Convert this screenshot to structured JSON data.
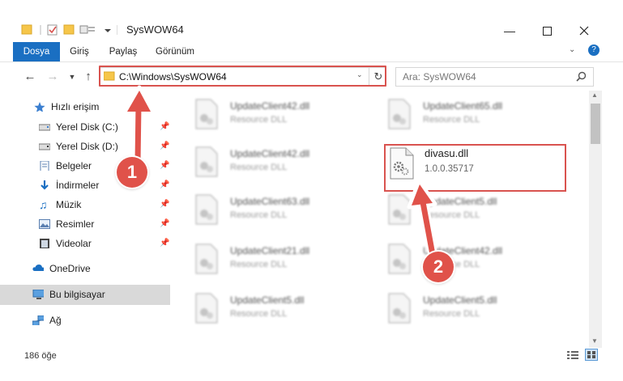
{
  "window": {
    "title": "SysWOW64"
  },
  "ribbon": {
    "tabs": [
      {
        "label": "Dosya"
      },
      {
        "label": "Giriş"
      },
      {
        "label": "Paylaş"
      },
      {
        "label": "Görünüm"
      }
    ]
  },
  "nav": {
    "address": "C:\\Windows\\SysWOW64",
    "search_placeholder": "Ara: SysWOW64"
  },
  "sidebar": {
    "items": [
      {
        "label": "Hızlı erişim"
      },
      {
        "label": "Yerel Disk (C:)"
      },
      {
        "label": "Yerel Disk (D:)"
      },
      {
        "label": "Belgeler"
      },
      {
        "label": "İndirmeler"
      },
      {
        "label": "Müzik"
      },
      {
        "label": "Resimler"
      },
      {
        "label": "Videolar"
      },
      {
        "label": "OneDrive"
      },
      {
        "label": "Bu bilgisayar"
      },
      {
        "label": "Ağ"
      }
    ]
  },
  "files": [
    {
      "name": "UpdateClient42.dll",
      "type": "Resource DLL"
    },
    {
      "name": "UpdateClient65.dll",
      "type": "Resource DLL"
    },
    {
      "name": "UpdateClient42.dll",
      "type": "Resource DLL"
    },
    {
      "name": "divasu.dll",
      "type": "1.0.0.35717"
    },
    {
      "name": "UpdateClient63.dll",
      "type": "Resource DLL"
    },
    {
      "name": "UpdateClient5.dll",
      "type": "Resource DLL"
    },
    {
      "name": "UpdateClient21.dll",
      "type": "Resource DLL"
    },
    {
      "name": "UpdateClient42.dll",
      "type": "Resource DLL"
    },
    {
      "name": "UpdateClient5.dll",
      "type": "Resource DLL"
    },
    {
      "name": "UpdateClient5.dll",
      "type": "Resource DLL"
    }
  ],
  "status": {
    "count": "186 öğe"
  },
  "annotations": [
    {
      "label": "1"
    },
    {
      "label": "2"
    }
  ],
  "colors": {
    "accent": "#1a6fc2",
    "highlight": "#d9534f",
    "selected": "#d9d9d9"
  }
}
